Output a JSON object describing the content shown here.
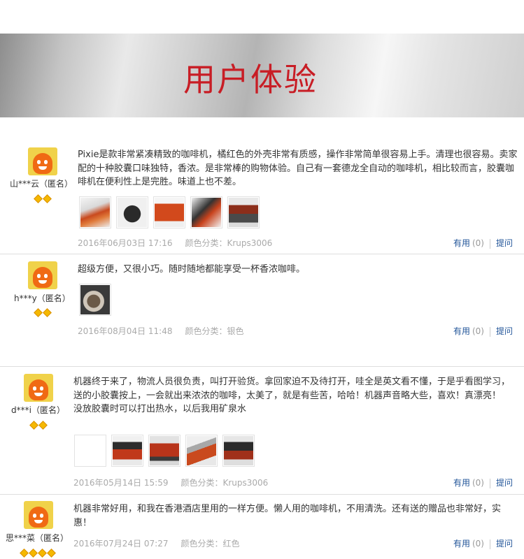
{
  "banner": {
    "title": "用户体验"
  },
  "colors": {
    "title_red": "#c81d25",
    "link_blue": "#225599",
    "diamond_gold": "#f5b800"
  },
  "reviews": [
    {
      "user": "山***云（匿名）",
      "level_icon": "diamond-icon",
      "diamonds": [
        "diamond-icon",
        "diamond-icon"
      ],
      "paragraphs": [
        "Pixie是款非常紧凑精致的咖啡机，橘红色的外壳非常有质感，操作非常简单很容易上手。清理也很容易。卖家配的十种胶囊口味独特，香浓。是非常棒的购物体验。自己有一套德龙全自动的咖啡机，相比较而言，胶囊咖啡机在便利性上是完胜。味道上也不差。"
      ],
      "photos": [
        "coffee-machine-photo",
        "coffee-machine-photo",
        "coffee-machine-photo",
        "coffee-machine-photo",
        "coffee-machine-photo"
      ],
      "date": "2016年06月03日 17:16",
      "sku": "颜色分类：Krups3006",
      "useful_label": "有用",
      "useful_count": "(0)",
      "ask_label": "提问"
    },
    {
      "user": "h***y（匿名）",
      "diamonds": [
        "diamond-icon",
        "diamond-icon"
      ],
      "paragraphs": [
        "超级方便，又很小巧。随时随地都能享受一杯香浓咖啡。"
      ],
      "photos": [
        "coffee-cup-photo"
      ],
      "date": "2016年08月04日 11:48",
      "sku": "颜色分类：银色",
      "useful_label": "有用",
      "useful_count": "(0)",
      "ask_label": "提问"
    },
    {
      "user": "d***i（匿名）",
      "diamonds": [
        "diamond-icon",
        "diamond-icon"
      ],
      "paragraphs": [
        "机器终于来了，物流人员很负责，叫打开验货。拿回家迫不及待打开，哇全是英文看不懂，于是乎看图学习，送的小胶囊按上，一会就出来浓浓的咖啡，太美了，就是有些苦，哈哈！机器声音略大些，喜欢！真漂亮！",
        "没放胶囊时可以打出热水，以后我用矿泉水"
      ],
      "photos": [
        "blank-photo",
        "coffee-machine-photo",
        "coffee-machine-photo",
        "coffee-machine-photo",
        "coffee-machine-photo"
      ],
      "date": "2016年05月14日 15:59",
      "sku": "颜色分类：Krups3006",
      "useful_label": "有用",
      "useful_count": "(0)",
      "ask_label": "提问"
    },
    {
      "user": "思***菜（匿名）",
      "diamonds": [
        "diamond-icon",
        "diamond-icon",
        "diamond-icon",
        "diamond-icon"
      ],
      "paragraphs": [
        "机器非常好用，和我在香港酒店里用的一样方便。懒人用的咖啡机，不用清洗。还有送的赠品也非常好，实惠！"
      ],
      "photos": [],
      "date": "2016年07月24日 07:27",
      "sku": "颜色分类：红色",
      "useful_label": "有用",
      "useful_count": "(0)",
      "ask_label": "提问"
    }
  ]
}
